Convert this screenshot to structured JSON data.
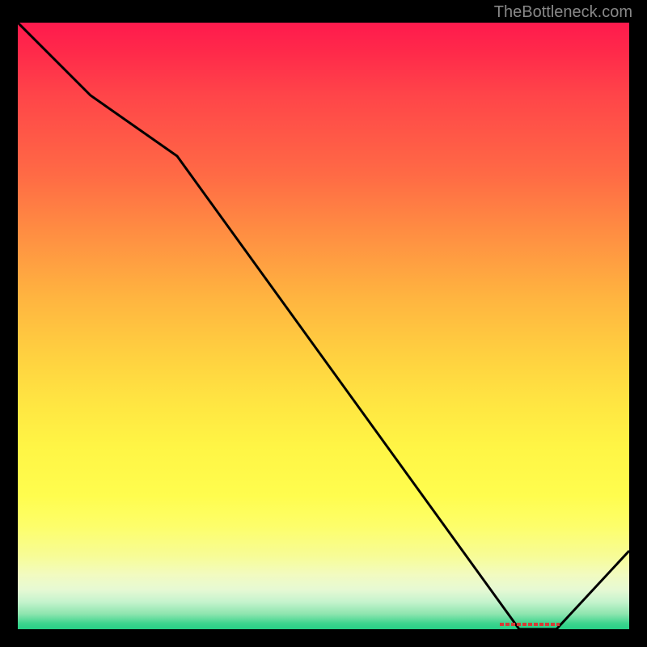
{
  "watermark": "TheBottleneck.com",
  "chart_data": {
    "type": "line",
    "title": "",
    "xlabel": "",
    "ylabel": "",
    "x": [
      0.0,
      0.12,
      0.26,
      0.82,
      0.88,
      1.0
    ],
    "values": [
      1.0,
      0.88,
      0.78,
      0.0,
      0.0,
      0.13
    ],
    "ylim": [
      0,
      1
    ],
    "xlim": [
      0,
      1
    ],
    "background_gradient": {
      "top": "#ff1a4d",
      "mid": "#ffe642",
      "bottom": "#26cf85"
    },
    "annotations": [
      {
        "text": "",
        "x": 0.85,
        "y": 0.0,
        "color": "#d43d36"
      }
    ]
  }
}
